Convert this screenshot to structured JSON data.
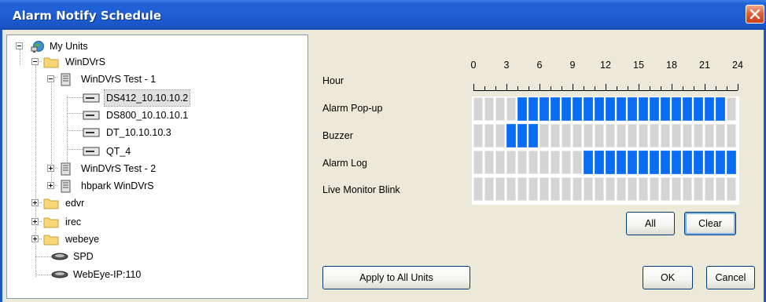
{
  "window": {
    "title": "Alarm Notify Schedule"
  },
  "tree": {
    "items": [
      {
        "label": "My Units"
      },
      {
        "label": "WinDVrS"
      },
      {
        "label": "WinDVrS Test - 1"
      },
      {
        "label": "DS412_10.10.10.2",
        "selected": true
      },
      {
        "label": "DS800_10.10.10.1"
      },
      {
        "label": "DT_10.10.10.3"
      },
      {
        "label": "QT_4"
      },
      {
        "label": "WinDVrS Test - 2"
      },
      {
        "label": "hbpark WinDVrS"
      },
      {
        "label": "edvr"
      },
      {
        "label": "irec"
      },
      {
        "label": "webeye"
      },
      {
        "label": "SPD"
      },
      {
        "label": "WebEye-IP:110"
      }
    ]
  },
  "schedule": {
    "hour_label": "Hour",
    "hour_ticks": [
      "0",
      "3",
      "6",
      "9",
      "12",
      "15",
      "18",
      "21",
      "24"
    ],
    "rows": [
      {
        "label": "Alarm Pop-up",
        "active_slots": [
          4,
          5,
          6,
          7,
          8,
          9,
          10,
          11,
          12,
          13,
          14,
          15,
          16,
          17,
          18,
          19,
          20,
          21,
          22
        ]
      },
      {
        "label": "Buzzer",
        "active_slots": [
          3,
          4,
          5
        ]
      },
      {
        "label": "Alarm Log",
        "active_slots": [
          10,
          11,
          12,
          13,
          14,
          15,
          16,
          17,
          18,
          19,
          20,
          21,
          22,
          23
        ]
      },
      {
        "label": "Live Monitor Blink",
        "active_slots": []
      }
    ],
    "slots_per_row": 24,
    "active_color": "#0a6cf0",
    "inactive_color": "#d4d4d4"
  },
  "buttons": {
    "all": "All",
    "clear": "Clear",
    "apply_all": "Apply to All Units",
    "ok": "OK",
    "cancel": "Cancel"
  }
}
